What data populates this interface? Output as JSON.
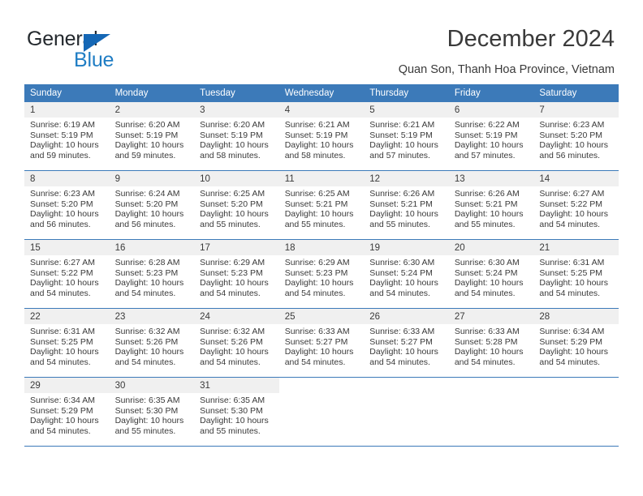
{
  "brand": {
    "name_part1": "General",
    "name_part2": "Blue",
    "triangle_color": "#1567b5",
    "blue_color": "#1f7dc4"
  },
  "header": {
    "title": "December 2024",
    "subtitle": "Quan Son, Thanh Hoa Province, Vietnam"
  },
  "theme": {
    "header_row_color": "#3c7ab9",
    "daynum_band_color": "#f0f0f0",
    "text_color": "#3a3a3a"
  },
  "weekdays": [
    "Sunday",
    "Monday",
    "Tuesday",
    "Wednesday",
    "Thursday",
    "Friday",
    "Saturday"
  ],
  "weeks": [
    [
      {
        "day": "1",
        "sunrise": "Sunrise: 6:19 AM",
        "sunset": "Sunset: 5:19 PM",
        "daylight1": "Daylight: 10 hours",
        "daylight2": "and 59 minutes."
      },
      {
        "day": "2",
        "sunrise": "Sunrise: 6:20 AM",
        "sunset": "Sunset: 5:19 PM",
        "daylight1": "Daylight: 10 hours",
        "daylight2": "and 59 minutes."
      },
      {
        "day": "3",
        "sunrise": "Sunrise: 6:20 AM",
        "sunset": "Sunset: 5:19 PM",
        "daylight1": "Daylight: 10 hours",
        "daylight2": "and 58 minutes."
      },
      {
        "day": "4",
        "sunrise": "Sunrise: 6:21 AM",
        "sunset": "Sunset: 5:19 PM",
        "daylight1": "Daylight: 10 hours",
        "daylight2": "and 58 minutes."
      },
      {
        "day": "5",
        "sunrise": "Sunrise: 6:21 AM",
        "sunset": "Sunset: 5:19 PM",
        "daylight1": "Daylight: 10 hours",
        "daylight2": "and 57 minutes."
      },
      {
        "day": "6",
        "sunrise": "Sunrise: 6:22 AM",
        "sunset": "Sunset: 5:19 PM",
        "daylight1": "Daylight: 10 hours",
        "daylight2": "and 57 minutes."
      },
      {
        "day": "7",
        "sunrise": "Sunrise: 6:23 AM",
        "sunset": "Sunset: 5:20 PM",
        "daylight1": "Daylight: 10 hours",
        "daylight2": "and 56 minutes."
      }
    ],
    [
      {
        "day": "8",
        "sunrise": "Sunrise: 6:23 AM",
        "sunset": "Sunset: 5:20 PM",
        "daylight1": "Daylight: 10 hours",
        "daylight2": "and 56 minutes."
      },
      {
        "day": "9",
        "sunrise": "Sunrise: 6:24 AM",
        "sunset": "Sunset: 5:20 PM",
        "daylight1": "Daylight: 10 hours",
        "daylight2": "and 56 minutes."
      },
      {
        "day": "10",
        "sunrise": "Sunrise: 6:25 AM",
        "sunset": "Sunset: 5:20 PM",
        "daylight1": "Daylight: 10 hours",
        "daylight2": "and 55 minutes."
      },
      {
        "day": "11",
        "sunrise": "Sunrise: 6:25 AM",
        "sunset": "Sunset: 5:21 PM",
        "daylight1": "Daylight: 10 hours",
        "daylight2": "and 55 minutes."
      },
      {
        "day": "12",
        "sunrise": "Sunrise: 6:26 AM",
        "sunset": "Sunset: 5:21 PM",
        "daylight1": "Daylight: 10 hours",
        "daylight2": "and 55 minutes."
      },
      {
        "day": "13",
        "sunrise": "Sunrise: 6:26 AM",
        "sunset": "Sunset: 5:21 PM",
        "daylight1": "Daylight: 10 hours",
        "daylight2": "and 55 minutes."
      },
      {
        "day": "14",
        "sunrise": "Sunrise: 6:27 AM",
        "sunset": "Sunset: 5:22 PM",
        "daylight1": "Daylight: 10 hours",
        "daylight2": "and 54 minutes."
      }
    ],
    [
      {
        "day": "15",
        "sunrise": "Sunrise: 6:27 AM",
        "sunset": "Sunset: 5:22 PM",
        "daylight1": "Daylight: 10 hours",
        "daylight2": "and 54 minutes."
      },
      {
        "day": "16",
        "sunrise": "Sunrise: 6:28 AM",
        "sunset": "Sunset: 5:23 PM",
        "daylight1": "Daylight: 10 hours",
        "daylight2": "and 54 minutes."
      },
      {
        "day": "17",
        "sunrise": "Sunrise: 6:29 AM",
        "sunset": "Sunset: 5:23 PM",
        "daylight1": "Daylight: 10 hours",
        "daylight2": "and 54 minutes."
      },
      {
        "day": "18",
        "sunrise": "Sunrise: 6:29 AM",
        "sunset": "Sunset: 5:23 PM",
        "daylight1": "Daylight: 10 hours",
        "daylight2": "and 54 minutes."
      },
      {
        "day": "19",
        "sunrise": "Sunrise: 6:30 AM",
        "sunset": "Sunset: 5:24 PM",
        "daylight1": "Daylight: 10 hours",
        "daylight2": "and 54 minutes."
      },
      {
        "day": "20",
        "sunrise": "Sunrise: 6:30 AM",
        "sunset": "Sunset: 5:24 PM",
        "daylight1": "Daylight: 10 hours",
        "daylight2": "and 54 minutes."
      },
      {
        "day": "21",
        "sunrise": "Sunrise: 6:31 AM",
        "sunset": "Sunset: 5:25 PM",
        "daylight1": "Daylight: 10 hours",
        "daylight2": "and 54 minutes."
      }
    ],
    [
      {
        "day": "22",
        "sunrise": "Sunrise: 6:31 AM",
        "sunset": "Sunset: 5:25 PM",
        "daylight1": "Daylight: 10 hours",
        "daylight2": "and 54 minutes."
      },
      {
        "day": "23",
        "sunrise": "Sunrise: 6:32 AM",
        "sunset": "Sunset: 5:26 PM",
        "daylight1": "Daylight: 10 hours",
        "daylight2": "and 54 minutes."
      },
      {
        "day": "24",
        "sunrise": "Sunrise: 6:32 AM",
        "sunset": "Sunset: 5:26 PM",
        "daylight1": "Daylight: 10 hours",
        "daylight2": "and 54 minutes."
      },
      {
        "day": "25",
        "sunrise": "Sunrise: 6:33 AM",
        "sunset": "Sunset: 5:27 PM",
        "daylight1": "Daylight: 10 hours",
        "daylight2": "and 54 minutes."
      },
      {
        "day": "26",
        "sunrise": "Sunrise: 6:33 AM",
        "sunset": "Sunset: 5:27 PM",
        "daylight1": "Daylight: 10 hours",
        "daylight2": "and 54 minutes."
      },
      {
        "day": "27",
        "sunrise": "Sunrise: 6:33 AM",
        "sunset": "Sunset: 5:28 PM",
        "daylight1": "Daylight: 10 hours",
        "daylight2": "and 54 minutes."
      },
      {
        "day": "28",
        "sunrise": "Sunrise: 6:34 AM",
        "sunset": "Sunset: 5:29 PM",
        "daylight1": "Daylight: 10 hours",
        "daylight2": "and 54 minutes."
      }
    ],
    [
      {
        "day": "29",
        "sunrise": "Sunrise: 6:34 AM",
        "sunset": "Sunset: 5:29 PM",
        "daylight1": "Daylight: 10 hours",
        "daylight2": "and 54 minutes."
      },
      {
        "day": "30",
        "sunrise": "Sunrise: 6:35 AM",
        "sunset": "Sunset: 5:30 PM",
        "daylight1": "Daylight: 10 hours",
        "daylight2": "and 55 minutes."
      },
      {
        "day": "31",
        "sunrise": "Sunrise: 6:35 AM",
        "sunset": "Sunset: 5:30 PM",
        "daylight1": "Daylight: 10 hours",
        "daylight2": "and 55 minutes."
      },
      {
        "day": "",
        "sunrise": "",
        "sunset": "",
        "daylight1": "",
        "daylight2": ""
      },
      {
        "day": "",
        "sunrise": "",
        "sunset": "",
        "daylight1": "",
        "daylight2": ""
      },
      {
        "day": "",
        "sunrise": "",
        "sunset": "",
        "daylight1": "",
        "daylight2": ""
      },
      {
        "day": "",
        "sunrise": "",
        "sunset": "",
        "daylight1": "",
        "daylight2": ""
      }
    ]
  ]
}
